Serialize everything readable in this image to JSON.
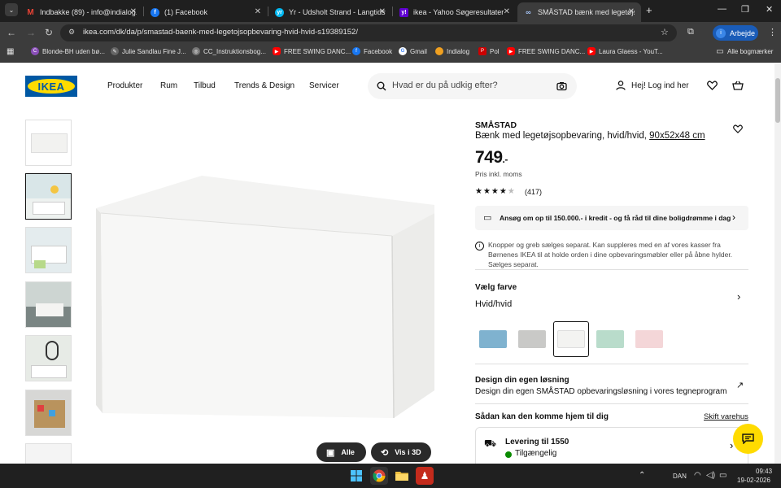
{
  "browser": {
    "tabs": [
      {
        "label": "Indbakke (89) - info@indialog.d"
      },
      {
        "label": "(1) Facebook"
      },
      {
        "label": "Yr - Udsholt Strand - Langtidsv"
      },
      {
        "label": "ikea - Yahoo Søgeresultater"
      },
      {
        "label": "SMÅSTAD bænk med legetøjsop"
      }
    ],
    "url": "ikea.com/dk/da/p/smastad-baenk-med-legetojsopbevaring-hvid-hvid-s19389152/",
    "profile_label": "Arbejde",
    "bookmarks": [
      {
        "label": "Blonde-BH uden bø..."
      },
      {
        "label": "Julie Sandlau Fine J..."
      },
      {
        "label": "CC_Instruktionsbog..."
      },
      {
        "label": "FREE SWING DANC..."
      },
      {
        "label": "Facebook"
      },
      {
        "label": "Gmail"
      },
      {
        "label": "Indialog"
      },
      {
        "label": "Pol"
      },
      {
        "label": "FREE SWING DANC..."
      },
      {
        "label": "Laura Glaess - YouT..."
      }
    ],
    "bookmarks_folder": "Alle bogmærker"
  },
  "site": {
    "logo": "IKEA",
    "nav": [
      "Produkter",
      "Rum",
      "Tilbud",
      "Trends & Design",
      "Servicer"
    ],
    "search_placeholder": "Hvad er du på udkig efter?",
    "login": "Hej! Log ind her"
  },
  "gallery": {
    "all_button": "Alle",
    "view3d_button": "Vis i 3D"
  },
  "product": {
    "name": "SMÅSTAD",
    "description": "Bænk med legetøjsopbevaring, hvid/hvid,",
    "size": "90x52x48 cm",
    "price": "749",
    "price_suffix": ".-",
    "vat_note": "Pris inkl. moms",
    "rating": 4.5,
    "review_count": "(417)",
    "credit_banner": "Ansøg om op til 150.000.- i kredit - og få råd til dine boligdrømme i dag",
    "info_note": "Knopper og greb sælges separat. Kan suppleres med en af vores kasser fra Børnenes IKEA til at holde orden i dine opbevaringsmøbler eller på åbne hylder. Sælges separat.",
    "color_heading": "Vælg farve",
    "color_value": "Hvid/hvid",
    "swatches": [
      {
        "color": "#7fb2cf"
      },
      {
        "color": "#c9c9c7"
      },
      {
        "color": "#f3f3f1"
      },
      {
        "color": "#b9dccb"
      },
      {
        "color": "#f4d6d8"
      }
    ],
    "design_heading": "Design din egen løsning",
    "design_sub": "Design din egen SMÅSTAD opbevaringsløsning i vores tegneprogram",
    "delivery_heading": "Sådan kan den komme hjem til dig",
    "change_store": "Skift varehus",
    "delivery_title": "Levering til 1550",
    "delivery_status": "Tilgængelig"
  },
  "taskbar": {
    "language": "DAN",
    "time": "09:43",
    "date": "19-02-2026"
  },
  "colors": {
    "ikea_blue": "#0058a3",
    "ikea_yellow": "#ffdb00",
    "available_green": "#0a8a00"
  }
}
